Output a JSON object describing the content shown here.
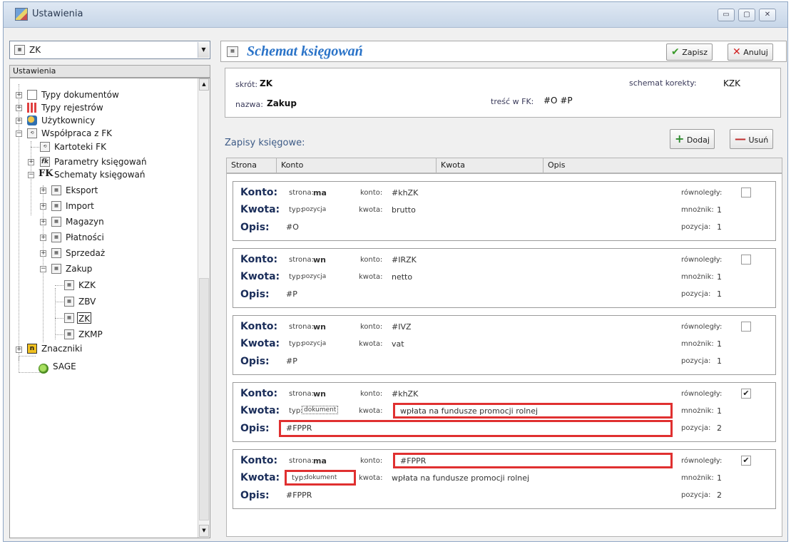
{
  "window": {
    "title": "Ustawienia",
    "buttons": {
      "minimize": "▭",
      "maximize": "▢",
      "close": "✕"
    }
  },
  "left": {
    "combo_value": "ZK",
    "tree_header": "Ustawienia",
    "tree": {
      "typy_dokumentow": "Typy dokumentów",
      "typy_rejestrow": "Typy rejestrów",
      "uzytkownicy": "Użytkownicy",
      "wspolpraca": "Współpraca z FK",
      "kartoteki": "Kartoteki FK",
      "parametry": "Parametry księgowań",
      "schematy": "Schematy księgowań",
      "eksport": "Eksport",
      "import": "Import",
      "magazyn": "Magazyn",
      "platnosci": "Płatności",
      "sprzedaz": "Sprzedaż",
      "zakup": "Zakup",
      "kzk": "KZK",
      "zbv": "ZBV",
      "zk": "ZK",
      "zkmp": "ZKMP",
      "znaczniki": "Znaczniki",
      "sage": "SAGE"
    }
  },
  "header": {
    "title": "Schemat księgowań",
    "save_label": "Zapisz",
    "cancel_label": "Anuluj"
  },
  "info": {
    "skrot_label": "skrót:",
    "skrot_value": "ZK",
    "schemat_korekty_label": "schemat korekty:",
    "schemat_korekty_value": "KZK",
    "nazwa_label": "nazwa:",
    "nazwa_value": "Zakup",
    "tresc_label": "treść w FK:",
    "tresc_value": "#O #P"
  },
  "entries_section": {
    "title": "Zapisy księgowe:",
    "add_label": "Dodaj",
    "remove_label": "Usuń",
    "columns": [
      "Strona",
      "Konto",
      "Kwota",
      "Opis"
    ]
  },
  "labels": {
    "konto": "Konto:",
    "kwota": "Kwota:",
    "opis": "Opis:",
    "strona": "strona:",
    "konto_small": "konto:",
    "typ": "typ:",
    "kwota_small": "kwota:",
    "rownolegly": "równoległy:",
    "mnoznik": "mnożnik:",
    "pozycja": "pozycja:"
  },
  "entries": [
    {
      "strona": "ma",
      "konto": "#khZK",
      "typ": "pozycja",
      "kwota": "brutto",
      "opis": "#O",
      "rownolegly": false,
      "mnoznik": "1",
      "pozycja": "1"
    },
    {
      "strona": "wn",
      "konto": "#IRZK",
      "typ": "pozycja",
      "kwota": "netto",
      "opis": "#P",
      "rownolegly": false,
      "mnoznik": "1",
      "pozycja": "1"
    },
    {
      "strona": "wn",
      "konto": "#IVZ",
      "typ": "pozycja",
      "kwota": "vat",
      "opis": "#P",
      "rownolegly": false,
      "mnoznik": "1",
      "pozycja": "1"
    },
    {
      "strona": "wn",
      "konto": "#khZK",
      "typ": "dokument",
      "kwota": "wpłata na fundusze promocji rolnej",
      "opis": "#FPPR",
      "rownolegly": true,
      "mnoznik": "1",
      "pozycja": "2"
    },
    {
      "strona": "ma",
      "konto": "#FPPR",
      "typ": "dokument",
      "kwota": "wpłata na fundusze promocji rolnej",
      "opis": "#FPPR",
      "rownolegly": true,
      "mnoznik": "1",
      "pozycja": "2"
    }
  ],
  "colors": {
    "accent_title": "#2a73c8",
    "highlight": "#e03030"
  }
}
